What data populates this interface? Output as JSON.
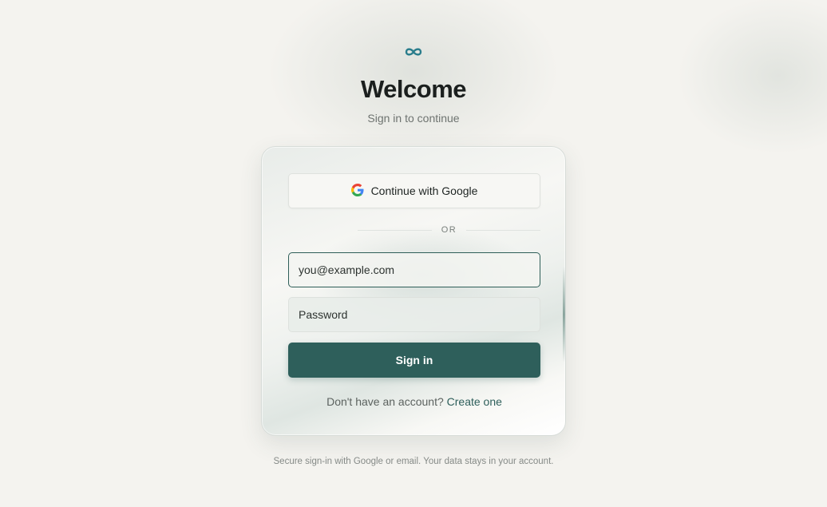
{
  "header": {
    "logo_icon": "infinity-icon",
    "title": "Welcome",
    "subtitle": "Sign in to continue"
  },
  "card": {
    "google_button": {
      "icon": "google-icon",
      "label": "Continue with Google"
    },
    "divider_label": "OR",
    "email": {
      "value": "",
      "placeholder": "you@example.com"
    },
    "password": {
      "value": "",
      "placeholder": "Password"
    },
    "submit_label": "Sign in",
    "signup_prompt": "Don't have an account?",
    "signup_link": "Create one"
  },
  "footer": {
    "text": "Secure sign-in with Google or email. Your data stays in your account."
  },
  "colors": {
    "accent": "#2e5f5b",
    "logo": "#2a7d8c",
    "background": "#f4f3ef"
  }
}
